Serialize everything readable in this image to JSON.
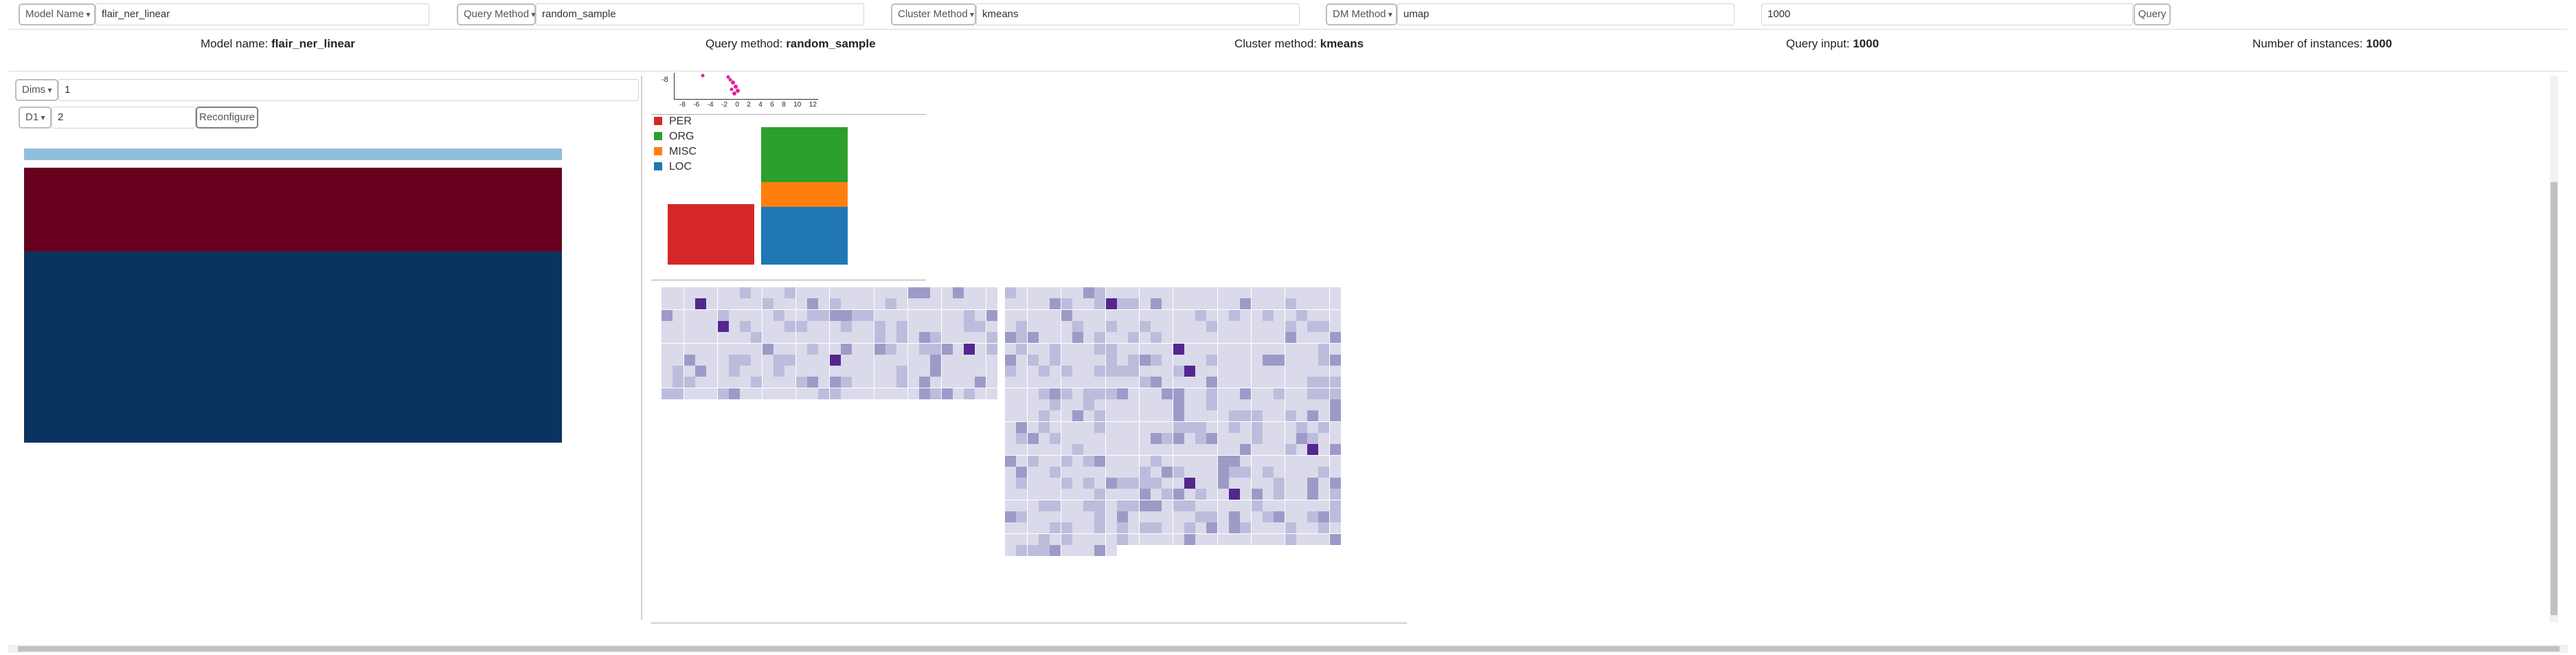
{
  "controls": {
    "model_name": {
      "label": "Model Name",
      "value": "flair_ner_linear"
    },
    "query_method": {
      "label": "Query Method",
      "value": "random_sample"
    },
    "cluster_method": {
      "label": "Cluster Method",
      "value": "kmeans"
    },
    "dm_method": {
      "label": "DM Method",
      "value": "umap"
    },
    "query_input": {
      "value": "1000"
    },
    "query_button": "Query"
  },
  "summary": {
    "model_name_label": "Model name:",
    "model_name_value": "flair_ner_linear",
    "query_method_label": "Query method:",
    "query_method_value": "random_sample",
    "cluster_method_label": "Cluster method:",
    "cluster_method_value": "kmeans",
    "query_input_label": "Query input:",
    "query_input_value": "1000",
    "instances_label": "Number of instances:",
    "instances_value": "1000"
  },
  "left_panel": {
    "dims_label": "Dims",
    "dims_value": "1",
    "d1_label": "D1",
    "d1_value": "2",
    "reconfigure_button": "Reconfigure",
    "colors": {
      "top_bar": "#8fbfdc",
      "middle": "#67001f",
      "bottom": "#0b3360"
    }
  },
  "scatter": {
    "y_tick": "-8",
    "x_ticks": [
      "-8",
      "-6",
      "-4",
      "-2",
      "0",
      "2",
      "4",
      "6",
      "8",
      "10",
      "12"
    ],
    "point_color": "#e0219b"
  },
  "legend": [
    {
      "label": "PER",
      "color": "#d62728"
    },
    {
      "label": "ORG",
      "color": "#2ca02c"
    },
    {
      "label": "MISC",
      "color": "#ff7f0e"
    },
    {
      "label": "LOC",
      "color": "#1f77b4"
    }
  ],
  "chart_data": {
    "type": "bar",
    "categories": [
      "PER",
      "ORG",
      "MISC",
      "LOC"
    ],
    "stacked": true,
    "values": [
      0.44,
      0.4,
      0.18,
      0.42
    ],
    "bars": [
      {
        "stack": "left",
        "segments": [
          {
            "label": "PER",
            "value": 0.44
          }
        ]
      },
      {
        "stack": "right",
        "segments": [
          {
            "label": "LOC",
            "value": 0.42
          },
          {
            "label": "MISC",
            "value": 0.18
          },
          {
            "label": "ORG",
            "value": 0.4
          }
        ]
      }
    ]
  },
  "heatmap": {
    "low_color": "#dadaeb",
    "mid_color": "#bcbddc",
    "high_color": "#9e9ac8",
    "max_color": "#54278f"
  }
}
